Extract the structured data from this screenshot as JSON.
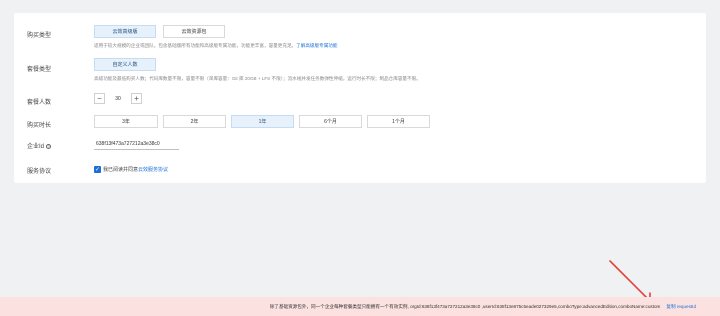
{
  "form": {
    "purchase_type": {
      "label": "购买类型",
      "options": [
        "云效高级版",
        "云效资源包"
      ],
      "selected": "云效高级版",
      "description": "适用于较大规模的企业或团队，包含基础版所有功能和高级版专属功能，功能更丰富，容量更充足。",
      "link": "了解高级版专属功能"
    },
    "package_type": {
      "label": "套餐类型",
      "options": [
        "自定义人数"
      ],
      "selected": "自定义人数",
      "description": "高级功能及最低购买人数；代码库数量不限，容量不限（单库容量：Git 库 20GB + LFS 不限）；流水线并发任务数弹性伸缩，运行时长不限；制品仓库容量不限。"
    },
    "members": {
      "label": "套餐人数",
      "minus": "−",
      "value": "30",
      "plus": "+"
    },
    "duration": {
      "label": "购买时长",
      "options": [
        "3年",
        "2年",
        "1年",
        "6个月",
        "1个月"
      ],
      "selected": "1年"
    },
    "enterprise_id": {
      "label": "企业Id",
      "help": "?",
      "value": "638f13f473a727212a3e38c0"
    },
    "agreement": {
      "label": "服务协议",
      "check": "✓",
      "text": "我已阅读并同意",
      "link": "云效服务协议"
    }
  },
  "footer": {
    "message": "除了基础资源包外，同一个企业每种套餐类型只能拥有一个有效实例, orgId:638f13f473a727212a3e38c0 ,userId:638f13e875c5eade027329e5,comboType:advancedEdition,comboName:custom",
    "copy_link": "复制 requestId"
  },
  "colors": {
    "page_bg": "#f0f1f3",
    "selected_bg": "#e6f1fb",
    "link": "#1d6fd6",
    "footer_bg": "#fbe1df",
    "arrow": "#e8403a"
  }
}
